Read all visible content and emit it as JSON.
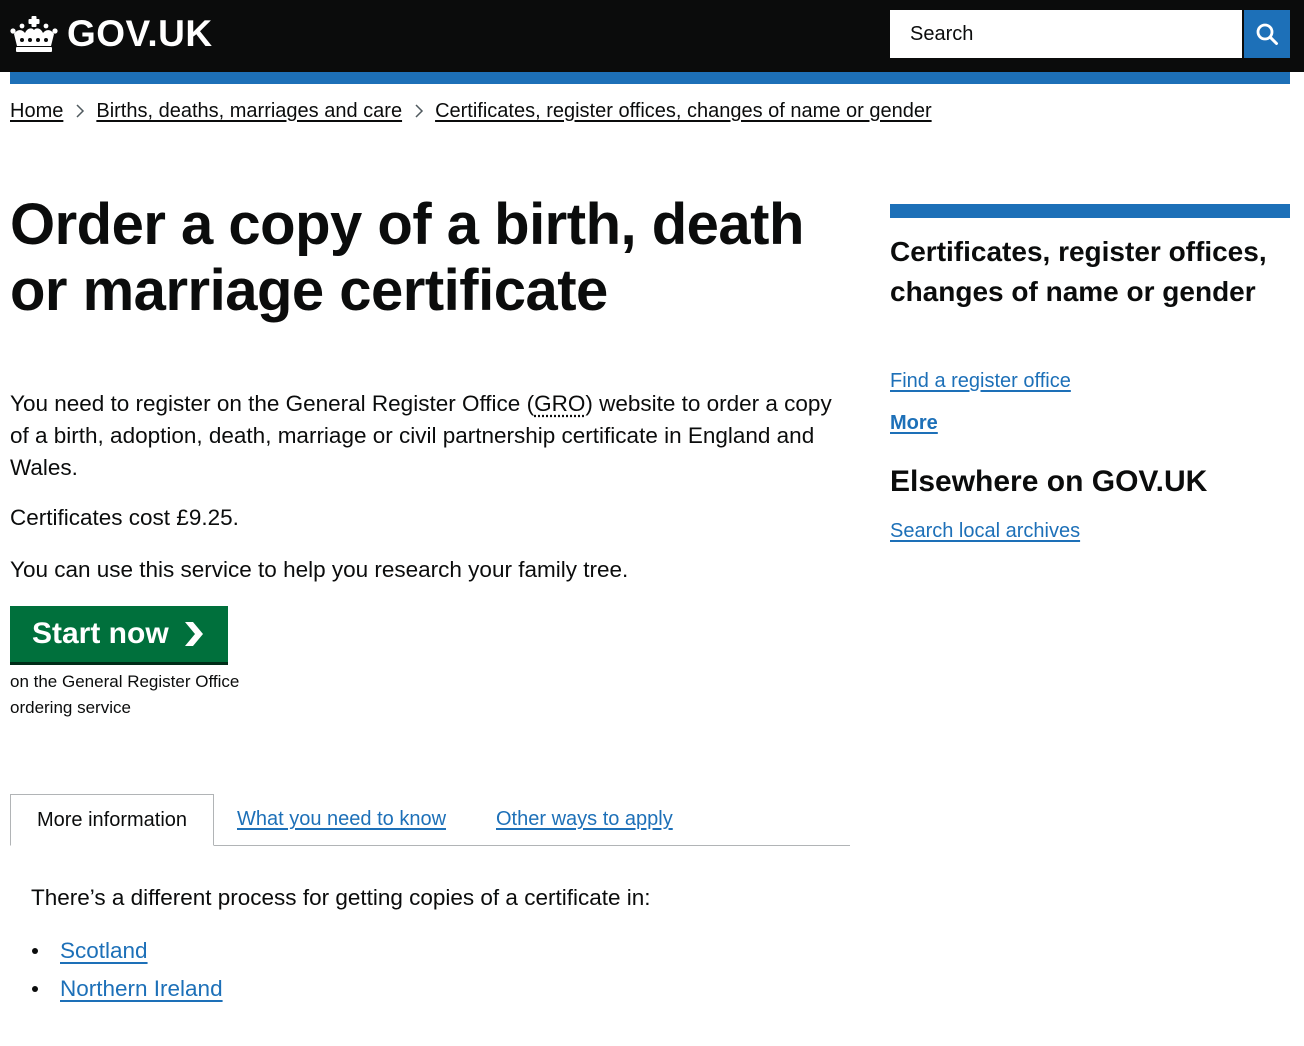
{
  "header": {
    "logo_text": "GOV.UK",
    "logo_icon": "crown-icon",
    "search_placeholder": "Search",
    "search_button_icon": "search-icon",
    "colors": {
      "background": "#0b0c0c",
      "accent": "#1d70b8"
    }
  },
  "breadcrumbs": [
    {
      "label": "Home"
    },
    {
      "label": "Births, deaths, marriages and care"
    },
    {
      "label": "Certificates, register offices, changes of name or gender"
    }
  ],
  "main": {
    "title": "Order a copy of a birth, death or marriage certificate",
    "intro_before": "You need to register on the General Register Office (",
    "intro_abbr": "GRO",
    "intro_after": ") website to order a copy of a birth, adoption, death, marriage or civil partnership certificate in England and Wales.",
    "cost": "Certificates cost £9.25.",
    "family_tree": "You can use this service to help you research your family tree.",
    "start_button": {
      "label": "Start now",
      "icon": "chevron-right-icon",
      "color": "#00703c"
    },
    "start_note": "on the General Register Office ordering service"
  },
  "tabs": [
    {
      "label": "More information",
      "active": true
    },
    {
      "label": "What you need to know",
      "active": false
    },
    {
      "label": "Other ways to apply",
      "active": false
    }
  ],
  "panel": {
    "text": "There’s a different process for getting copies of a certificate in:",
    "links": [
      "Scotland",
      "Northern Ireland"
    ]
  },
  "sidebar": {
    "title": "Certificates, register offices, changes of name or gender",
    "link": "Find a register office",
    "more": "More",
    "elsewhere_title": "Elsewhere on GOV.UK",
    "elsewhere_link": "Search local archives"
  }
}
